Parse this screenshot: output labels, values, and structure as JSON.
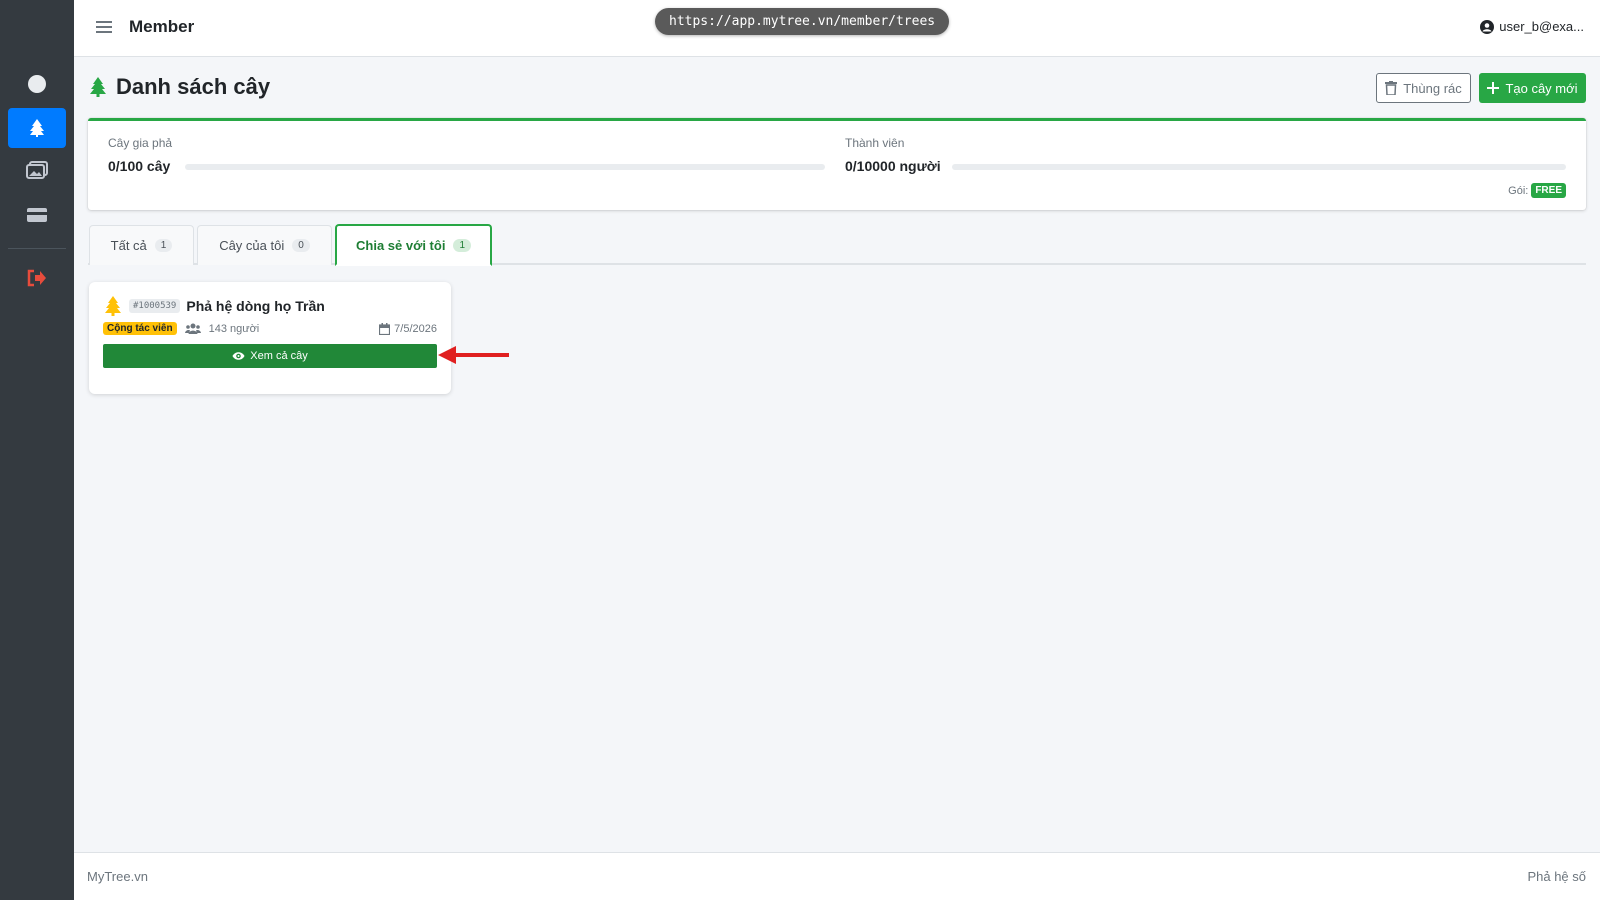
{
  "header": {
    "title": "Member",
    "url": "https://app.mytree.vn/member/trees",
    "user": "user_b@exa..."
  },
  "page": {
    "title": "Danh sách cây",
    "trash_label": "Thùng rác",
    "new_label": "Tạo cây mới"
  },
  "quota": {
    "trees_label": "Cây gia phả",
    "trees_value": "0/100 cây",
    "trees_fraction": 0,
    "members_label": "Thành viên",
    "members_value": "0/10000 người",
    "members_fraction": 0,
    "plan_label": "Gói:",
    "plan_value": "FREE"
  },
  "tabs": [
    {
      "label": "Tất cả",
      "count": "1"
    },
    {
      "label": "Cây của tôi",
      "count": "0"
    },
    {
      "label": "Chia sẻ với tôi",
      "count": "1"
    }
  ],
  "tree": {
    "id": "#1000539",
    "name": "Phả hệ dòng họ Trần",
    "role": "Cộng tác viên",
    "members": "143 người",
    "date": "7/5/2026",
    "view_label": "Xem cả cây"
  },
  "footer": {
    "left": "MyTree.vn",
    "right": "Phả hệ số"
  },
  "colors": {
    "accent": "#28a745",
    "sidebar": "#343a40",
    "active_nav": "#007bff",
    "role_badge": "#ffc107",
    "annotation_arrow": "#e02020"
  },
  "sidebar": {
    "items": [
      "circle-icon",
      "tree-icon",
      "images-icon",
      "card-icon",
      "logout-icon"
    ]
  }
}
